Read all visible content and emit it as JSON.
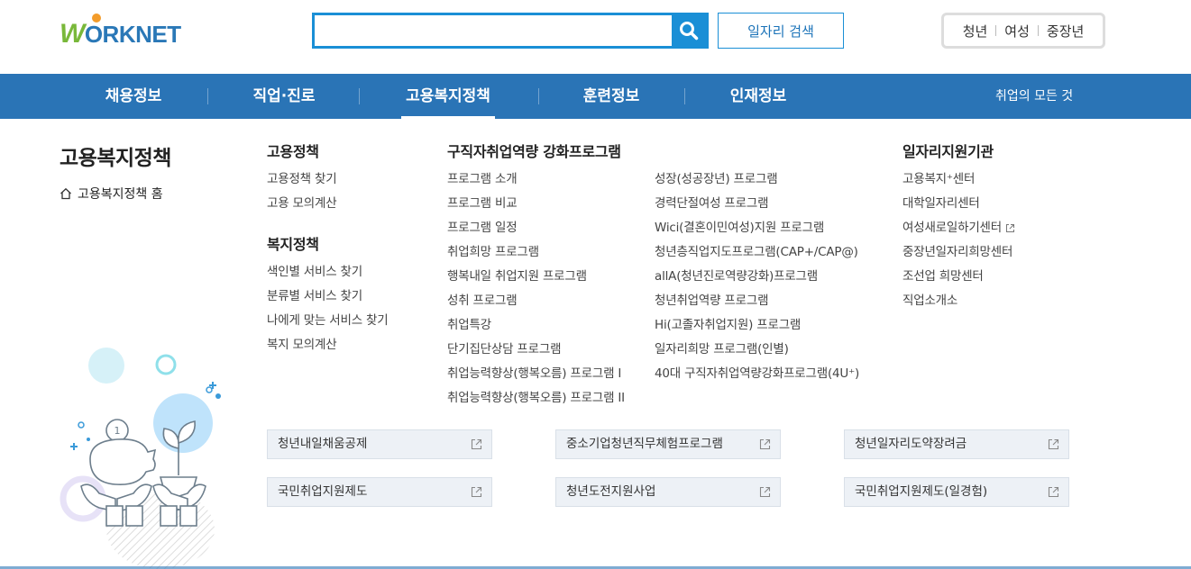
{
  "logo": {
    "w": "W",
    "rest": "ORKNET"
  },
  "search": {
    "placeholder": "",
    "value": "",
    "job_search_label": "일자리 검색"
  },
  "targets": [
    "청년",
    "여성",
    "중장년"
  ],
  "nav": {
    "items": [
      "채용정보",
      "직업·진로",
      "고용복지정책",
      "훈련정보",
      "인재정보"
    ],
    "active": "고용복지정책",
    "all_label": "취업의 모든 것"
  },
  "side": {
    "title": "고용복지정책",
    "home_label": "고용복지정책 홈"
  },
  "col_employment": {
    "title": "고용정책",
    "items": [
      "고용정책 찾기",
      "고용 모의계산"
    ]
  },
  "col_welfare": {
    "title": "복지정책",
    "items": [
      "색인별 서비스 찾기",
      "분류별 서비스 찾기",
      "나에게 맞는 서비스 찾기",
      "복지 모의계산"
    ]
  },
  "col_program": {
    "title": "구직자취업역량 강화프로그램",
    "left": [
      "프로그램 소개",
      "프로그램 비교",
      "프로그램 일정",
      "취업희망 프로그램",
      "행복내일 취업지원 프로그램",
      "성취 프로그램",
      "취업특강",
      "단기집단상담 프로그램",
      "취업능력향상(행복오름) 프로그램 I",
      "취업능력향상(행복오름) 프로그램 II"
    ],
    "right": [
      "성장(성공장년) 프로그램",
      "경력단절여성 프로그램",
      "Wici(결혼이민여성)지원 프로그램",
      "청년층직업지도프로그램(CAP+/CAP@)",
      "allA(청년진로역량강화)프로그램",
      "청년취업역량 프로그램",
      "Hi(고졸자취업지원) 프로그램",
      "일자리희망 프로그램(인별)",
      "40대 구직자취업역량강화프로그램(4U⁺)"
    ]
  },
  "col_agency": {
    "title": "일자리지원기관",
    "items": [
      "고용복지⁺센터",
      "대학일자리센터",
      "여성새로일하기센터",
      "중장년일자리희망센터",
      "조선업 희망센터",
      "직업소개소"
    ]
  },
  "box_links": [
    "청년내일채움공제",
    "중소기업청년직무체험프로그램",
    "청년일자리도약장려금",
    "국민취업지원제도",
    "청년도전지원사업",
    "국민취업지원제도(일경험)"
  ],
  "colors": {
    "nav_bg": "#2a74b6",
    "accent": "#1a8fd6",
    "logo_green": "#79b83a",
    "logo_blue": "#2a78b7"
  },
  "icons": [
    "search-icon",
    "home-icon",
    "external-link-icon",
    "piggy-bank-illustration"
  ]
}
